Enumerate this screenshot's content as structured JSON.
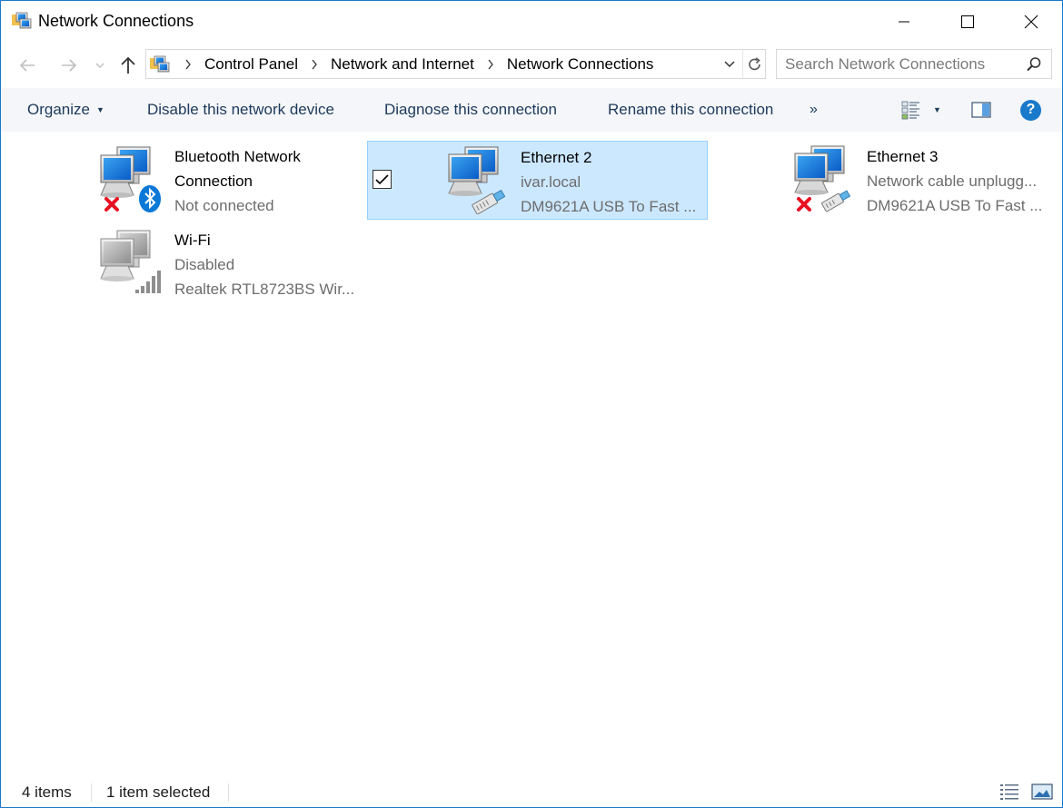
{
  "window": {
    "title": "Network Connections"
  },
  "address": {
    "crumbs": [
      "Control Panel",
      "Network and Internet",
      "Network Connections"
    ]
  },
  "search": {
    "placeholder": "Search Network Connections"
  },
  "toolbar": {
    "organize": "Organize",
    "disable": "Disable this network device",
    "diagnose": "Diagnose this connection",
    "rename": "Rename this connection",
    "more": "»",
    "help": "?"
  },
  "connections": [
    {
      "name": "Bluetooth Network Connection",
      "name_line1": "Bluetooth Network",
      "name_line2": "Connection",
      "status": "Not connected",
      "device": "",
      "selected": false,
      "icon": "bluetooth-network-icon"
    },
    {
      "name": "Ethernet 2",
      "status": "ivar.local",
      "device": "DM9621A USB To Fast ...",
      "selected": true,
      "icon": "ethernet-network-icon"
    },
    {
      "name": "Ethernet 3",
      "status": "Network cable unplugg...",
      "device": "DM9621A USB To Fast ...",
      "selected": false,
      "icon": "ethernet-disconnected-icon"
    },
    {
      "name": "Wi-Fi",
      "status": "Disabled",
      "device": "Realtek RTL8723BS Wir...",
      "selected": false,
      "icon": "wifi-disabled-icon"
    }
  ],
  "status": {
    "count": "4 items",
    "selected": "1 item selected"
  },
  "colors": {
    "accent": "#1979ca",
    "selection_fill": "#cce8ff",
    "selection_border": "#99d1ff",
    "toolbar_bg": "#f4f6f9",
    "command_text": "#1e395b",
    "secondary_text": "#6d6d6d",
    "error_red": "#e81123"
  }
}
